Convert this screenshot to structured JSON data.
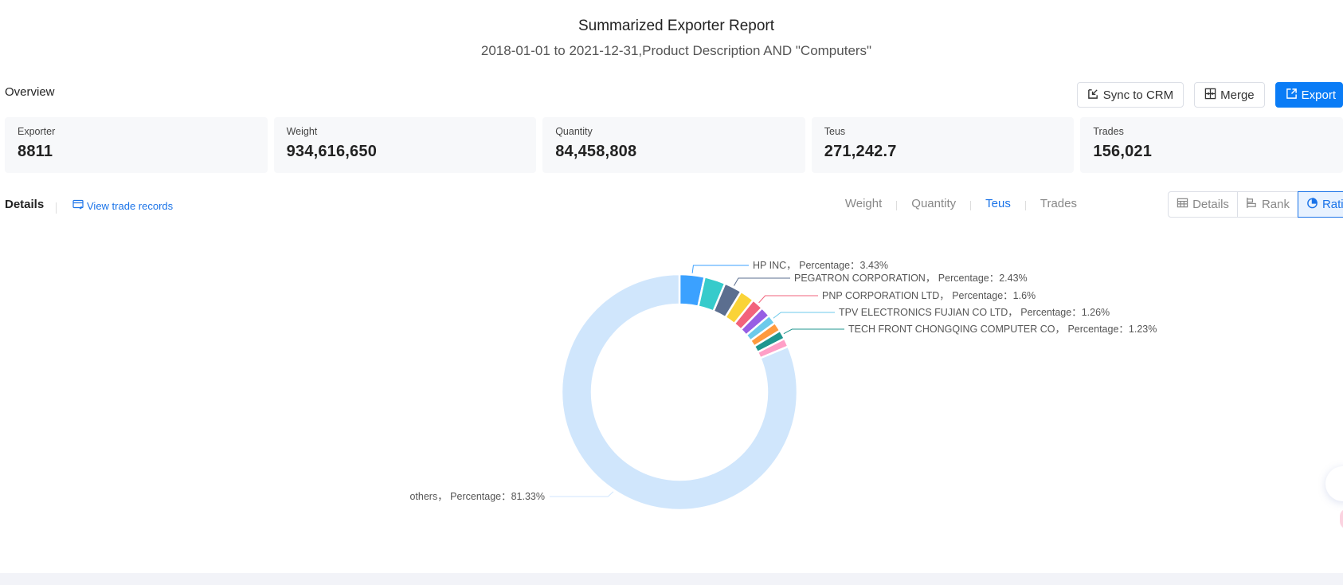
{
  "header": {
    "title": "Summarized Exporter Report",
    "subtitle": "2018-01-01 to 2021-12-31,Product Description AND \"Computers\""
  },
  "overview": {
    "label": "Overview",
    "toolbar": {
      "sync_label": "Sync to CRM",
      "merge_label": "Merge",
      "export_label": "Export"
    },
    "cards": [
      {
        "label": "Exporter",
        "value": "8811"
      },
      {
        "label": "Weight",
        "value": "934,616,650"
      },
      {
        "label": "Quantity",
        "value": "84,458,808"
      },
      {
        "label": "Teus",
        "value": "271,242.7"
      },
      {
        "label": "Trades",
        "value": "156,021"
      }
    ]
  },
  "details": {
    "title": "Details",
    "view_link": "View trade records",
    "metric_tabs": [
      {
        "label": "Weight",
        "active": false
      },
      {
        "label": "Quantity",
        "active": false
      },
      {
        "label": "Teus",
        "active": true
      },
      {
        "label": "Trades",
        "active": false
      }
    ],
    "view_toggle": [
      {
        "label": "Details",
        "icon": "table-icon",
        "active": false
      },
      {
        "label": "Rank",
        "icon": "bar-rank-icon",
        "active": false
      },
      {
        "label": "Ratio",
        "icon": "pie-icon",
        "active": true
      }
    ]
  },
  "colors": {
    "accent": "#0a7cf6",
    "link": "#1a73e8"
  },
  "chart_data": {
    "type": "pie",
    "style": "donut",
    "title": "",
    "label_format": "{name}，  Percentage：{value}%",
    "slices": [
      {
        "name": "HP INC",
        "value": 3.43,
        "color": "#3ba1ff",
        "label_visible": true
      },
      {
        "name": "",
        "value": 2.9,
        "color": "#36cbcb",
        "label_visible": false
      },
      {
        "name": "PEGATRON CORPORATION",
        "value": 2.43,
        "color": "#5b6e8f",
        "label_visible": true
      },
      {
        "name": "",
        "value": 2.0,
        "color": "#fad337",
        "label_visible": false
      },
      {
        "name": "PNP CORPORATION LTD",
        "value": 1.6,
        "color": "#f2637b",
        "label_visible": true
      },
      {
        "name": "",
        "value": 1.4,
        "color": "#975fe4",
        "label_visible": false
      },
      {
        "name": "TPV ELECTRONICS FUJIAN CO LTD",
        "value": 1.26,
        "color": "#6ccaeb",
        "label_visible": true
      },
      {
        "name": "",
        "value": 1.24,
        "color": "#ff9a3e",
        "label_visible": false
      },
      {
        "name": "TECH FRONT CHONGQING COMPUTER CO",
        "value": 1.23,
        "color": "#1f968f",
        "label_visible": true
      },
      {
        "name": "",
        "value": 1.18,
        "color": "#ff9fc7",
        "label_visible": false
      },
      {
        "name": "others",
        "value": 81.33,
        "color": "#d0e6fc",
        "label_visible": true
      }
    ]
  }
}
